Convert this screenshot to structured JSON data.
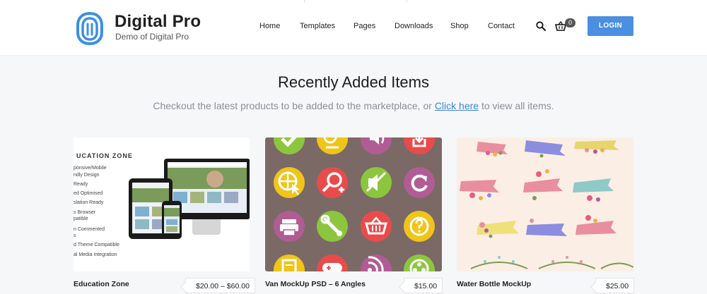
{
  "brand": {
    "title": "Digital Pro",
    "subtitle": "Demo of Digital Pro",
    "logo_icon": "fingerprint-logo",
    "accent": "#3b8fe2"
  },
  "nav": {
    "items": [
      {
        "label": "Home"
      },
      {
        "label": "Templates"
      },
      {
        "label": "Pages"
      },
      {
        "label": "Downloads"
      },
      {
        "label": "Shop"
      },
      {
        "label": "Contact"
      }
    ],
    "search_icon": "search-icon",
    "cart_icon": "cart-icon",
    "cart_count": "0",
    "login_label": "LOGIN",
    "login_color": "#4a8fe0"
  },
  "section": {
    "title": "Recently Added Items",
    "subtitle_before": "Checkout the latest products to be added to the marketplace, or ",
    "subtitle_link": "Click here",
    "subtitle_after": " to view all items."
  },
  "products": [
    {
      "name": "Education Zone",
      "price": "$20.00 – $60.00",
      "image_text": {
        "title": "UCATION ZONE",
        "lines": [
          "ponsive/Mobile",
          "ndly Design",
          "Ready",
          "ed Optimised",
          "slation Ready",
          "s Browser",
          "patible",
          "n Commented",
          "s",
          "d Theme Compatible",
          "al Media Integration"
        ]
      }
    },
    {
      "name": "Van MockUp PSD – 6 Angles",
      "price": "$15.00",
      "icons": [
        "check-icon",
        "zoom-out-icon",
        "volume-icon",
        "download-icon",
        "globe-cursor-icon",
        "zoom-in-icon",
        "mute-icon",
        "refresh-icon",
        "printer-icon",
        "wrench-icon",
        "basket-icon",
        "question-icon",
        "note-icon",
        "gamepad-icon",
        "rss-icon",
        "film-icon"
      ]
    },
    {
      "name": "Water Bottle MockUp",
      "price": "$25.00"
    }
  ]
}
